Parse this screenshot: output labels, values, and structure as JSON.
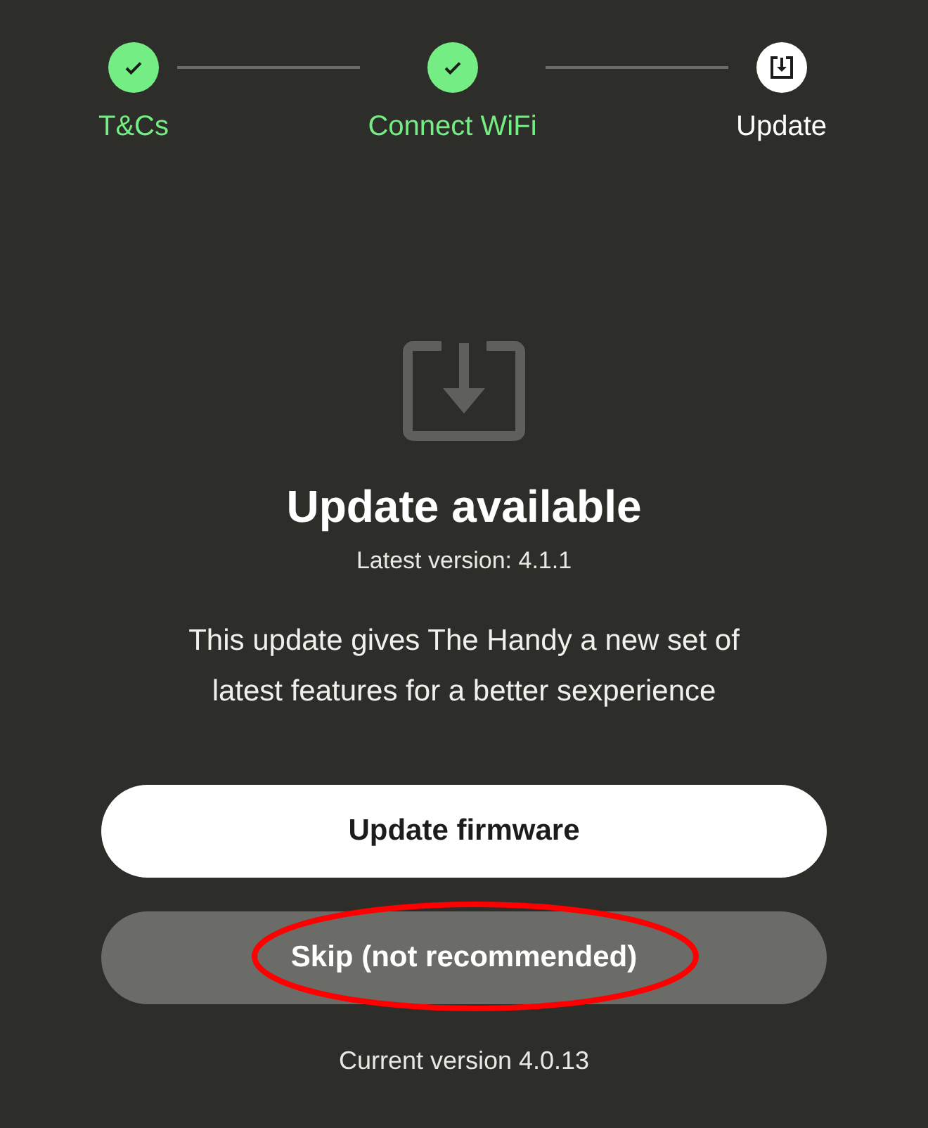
{
  "steps": [
    {
      "label": "T&Cs",
      "completed": true
    },
    {
      "label": "Connect WiFi",
      "completed": true
    },
    {
      "label": "Update",
      "completed": false
    }
  ],
  "update": {
    "title": "Update available",
    "latest_version": "Latest version: 4.1.1",
    "description": "This update gives The Handy a new set of latest features for a better sexperience"
  },
  "buttons": [
    {
      "label": "Update firmware",
      "kind": "primary",
      "circled": false
    },
    {
      "label": "Skip (not recommended)",
      "kind": "secondary",
      "circled": true
    }
  ],
  "current_version": "Current version 4.0.13"
}
